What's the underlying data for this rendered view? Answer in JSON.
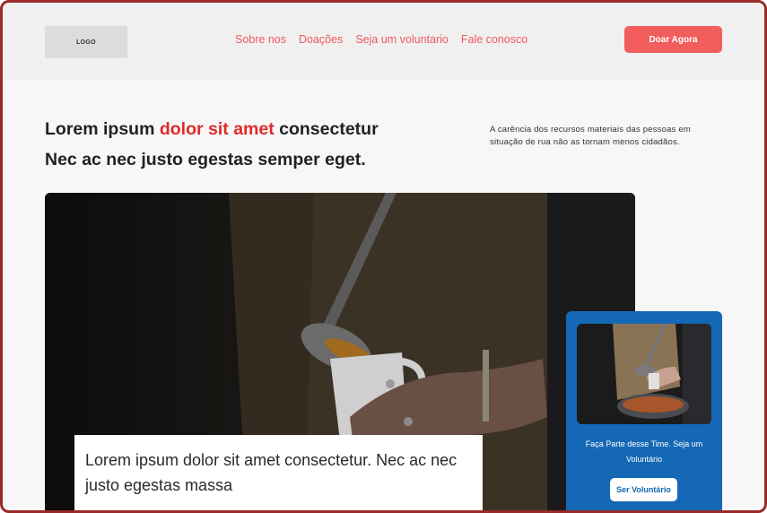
{
  "header": {
    "logo_text": "LOGO",
    "nav": [
      {
        "label": "Sobre nos"
      },
      {
        "label": "Doações"
      },
      {
        "label": "Seja um voluntario"
      },
      {
        "label": "Fale conosco"
      }
    ],
    "donate_label": "Doar Agora"
  },
  "hero": {
    "title_part1": "Lorem ipsum ",
    "title_accent": "dolor sit amet",
    "title_part2": " consectetur",
    "title_line2": "Nec ac  nec justo egestas semper eget.",
    "side_text": "A carência dos recursos materiais das pessoas em situação de rua não as tornam menos cidadãos."
  },
  "caption": {
    "text": "Lorem ipsum dolor sit amet consectetur. Nec ac nec justo egestas massa"
  },
  "volunteer_card": {
    "text": "Faça Parte desse Time. Seja um Voluntário",
    "button_label": "Ser Voluntário"
  },
  "colors": {
    "accent": "#f25d5d",
    "title_accent": "#e02a2a",
    "card_blue": "#1568b5"
  }
}
